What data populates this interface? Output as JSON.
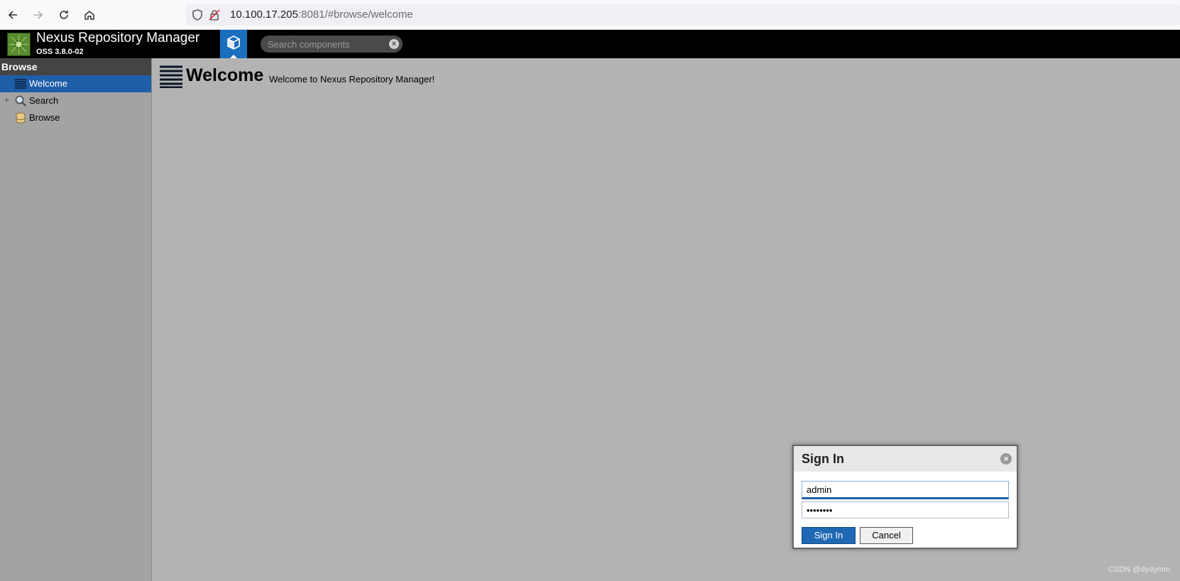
{
  "browser": {
    "url_host": "10.100.17.205",
    "url_rest": ":8081/#browse/welcome"
  },
  "app": {
    "title": "Nexus Repository Manager",
    "version": "OSS 3.8.0-02",
    "search_placeholder": "Search components"
  },
  "sidebar": {
    "header": "Browse",
    "items": [
      {
        "label": "Welcome",
        "icon": "welcome-lines-icon",
        "selected": true
      },
      {
        "label": "Search",
        "icon": "magnifier-icon",
        "expandable": true
      },
      {
        "label": "Browse",
        "icon": "database-icon"
      }
    ]
  },
  "main": {
    "title": "Welcome",
    "subtitle": "Welcome to Nexus Repository Manager!"
  },
  "signin": {
    "title": "Sign In",
    "username": "admin",
    "password_mask": "••••••••",
    "sign_in_label": "Sign In",
    "cancel_label": "Cancel"
  },
  "watermark": "CSDN @dydymm",
  "colors": {
    "header_bg": "#000000",
    "accent": "#1f5ea8",
    "content_bg": "#b3b3b3",
    "sidebar_bg": "#a3a3a3"
  }
}
